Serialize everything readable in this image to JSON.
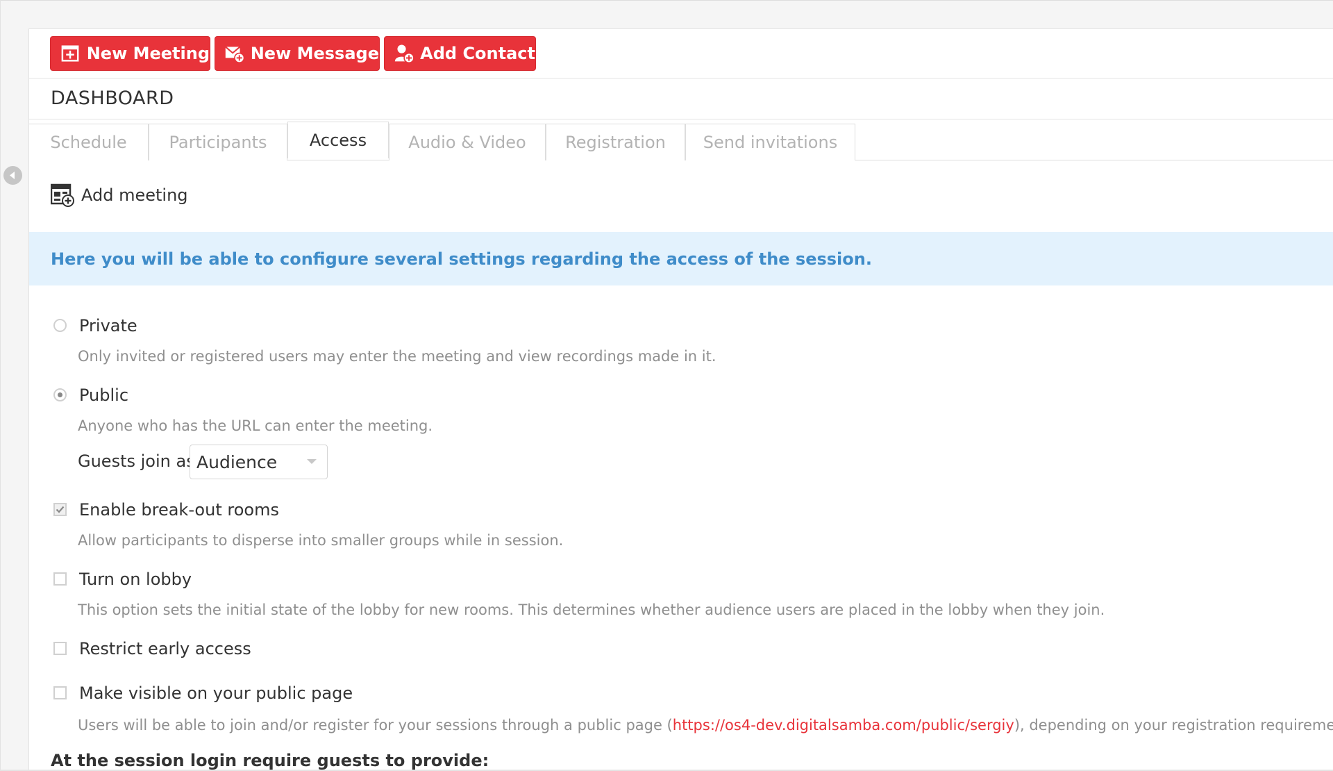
{
  "toolbar": {
    "new_meeting": {
      "label": "New Meeting",
      "icon": "calendar-plus-icon"
    },
    "new_message": {
      "label": "New Message",
      "icon": "envelope-plus-icon"
    },
    "add_contact": {
      "label": "Add Contact",
      "icon": "user-plus-icon"
    }
  },
  "header": {
    "title": "DASHBOARD"
  },
  "tabs": [
    {
      "label": "Schedule",
      "active": false
    },
    {
      "label": "Participants",
      "active": false
    },
    {
      "label": "Access",
      "active": true
    },
    {
      "label": "Audio & Video",
      "active": false
    },
    {
      "label": "Registration",
      "active": false
    },
    {
      "label": "Send invitations",
      "active": false
    }
  ],
  "section": {
    "title": "Add meeting",
    "icon": "add-meeting-icon"
  },
  "info_banner": {
    "text": "Here you will be able to configure several settings regarding the access of the session."
  },
  "access": {
    "private": {
      "label": "Private",
      "description": "Only invited or registered users may enter the meeting and view recordings made in it.",
      "selected": false
    },
    "public": {
      "label": "Public",
      "description": "Anyone who has the URL can enter the meeting.",
      "selected": true
    },
    "guests_join_as": {
      "label": "Guests join as",
      "value": "Audience"
    }
  },
  "options": {
    "breakout": {
      "label": "Enable break-out rooms",
      "description": "Allow participants to disperse into smaller groups while in session.",
      "checked": true
    },
    "lobby": {
      "label": "Turn on lobby",
      "description": "This option sets the initial state of the lobby for new rooms. This determines whether audience users are placed in the lobby when they join.",
      "checked": false
    },
    "restrict_early": {
      "label": "Restrict early access",
      "checked": false
    },
    "public_page": {
      "label": "Make visible on your public page",
      "description_pre": "Users will be able to join and/or register for your sessions through a public page (",
      "link": "https://os4-dev.digitalsamba.com/public/sergiy",
      "description_post": "), depending on your registration requirements setti",
      "checked": false
    }
  },
  "login_requirements": {
    "heading": "At the session login require guests to provide:"
  },
  "colors": {
    "accent": "#e8333a",
    "banner_bg": "#e3f2fd",
    "banner_text": "#3f8cc9",
    "muted_text": "#8f8f8f"
  }
}
